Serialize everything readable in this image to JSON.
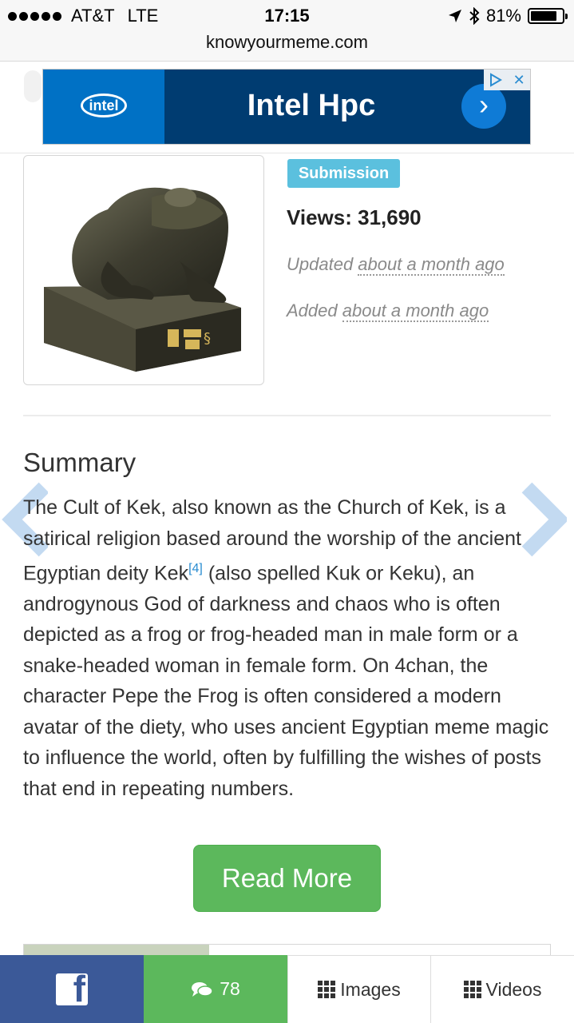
{
  "status_bar": {
    "carrier": "AT&T",
    "network": "LTE",
    "time": "17:15",
    "battery": "81%"
  },
  "browser": {
    "url": "knowyourmeme.com"
  },
  "ad": {
    "brand": "intel",
    "title": "Intel Hpc",
    "arrow": "›",
    "choices_icon": "ad-choices-icon",
    "close": "✕"
  },
  "entry": {
    "badge": "Submission",
    "views": "Views: 31,690",
    "updated_prefix": "Updated ",
    "updated_value": "about a month ago",
    "added_prefix": "Added ",
    "added_value": "about a month ago"
  },
  "summary": {
    "heading": "Summary",
    "text_before_ref": "The Cult of Kek, also known as the Church of Kek, is a satirical religion based around the worship of the ancient Egyptian deity Kek",
    "ref": "[4]",
    "text_after_ref": " (also spelled Kuk or Keku), an androgynous God of darkness and chaos who is often depicted as a frog or frog-headed man in male form or a snake-headed woman in female form. On 4chan, the character Pepe the Frog is often considered a modern avatar of the diety, who uses ancient Egyptian meme magic to influence the world, often by fulfilling the wishes of posts that end in repeating numbers.",
    "read_more": "Read More"
  },
  "bottom_bar": {
    "facebook_icon": "facebook-icon",
    "comments_count": "78",
    "images_label": "Images",
    "videos_label": "Videos"
  },
  "colors": {
    "badge": "#5bc0de",
    "read_more": "#5cb85c",
    "facebook": "#3b5998",
    "ad_bg": "#003c71"
  }
}
